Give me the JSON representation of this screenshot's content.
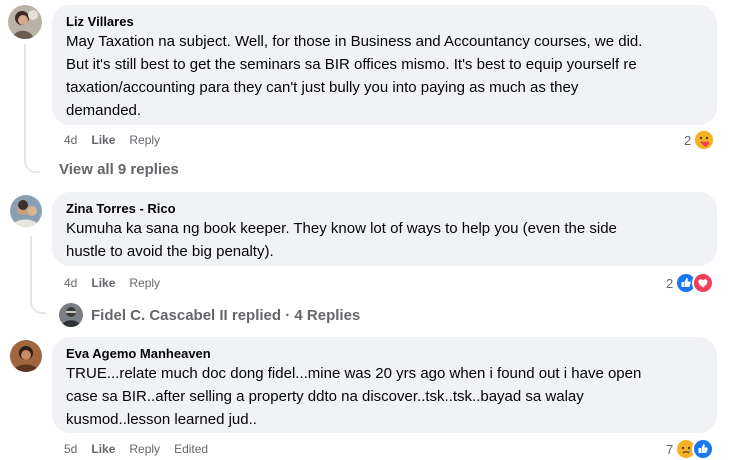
{
  "comments": [
    {
      "author": "Liz Villares",
      "lines": [
        "May Taxation na subject. Well, for those in Business and Accountancy courses, we did.",
        "But it's still best to get the seminars sa BIR offices mismo. It's best to equip yourself re",
        "taxation/accounting para they can't just bully you into paying as much as they",
        "demanded."
      ],
      "time": "4d",
      "like": "Like",
      "reply": "Reply",
      "reaction_count": "2",
      "reactions": [
        "care-icon"
      ]
    },
    {
      "author": "Zina Torres - Rico",
      "lines": [
        "Kumuha ka sana ng book keeper. They know lot of ways to help you (even the side",
        "hustle to avoid the big penalty)."
      ],
      "time": "4d",
      "like": "Like",
      "reply": "Reply",
      "reaction_count": "2",
      "reactions": [
        "like-icon",
        "love-icon"
      ]
    },
    {
      "author": "Eva Agemo Manheaven",
      "lines": [
        "TRUE...relate much doc dong fidel...mine was 20 yrs ago when i found out i have open",
        "case sa BIR..after selling a property ddto na discover..tsk..tsk..bayad sa walay",
        "kusmod..lesson learned jud.."
      ],
      "time": "5d",
      "like": "Like",
      "reply": "Reply",
      "edited": "Edited",
      "reaction_count": "7",
      "reactions": [
        "sad-icon",
        "like-icon"
      ]
    }
  ],
  "view_replies": "View all 9 replies",
  "replied": "Fidel C. Cascabel II replied · 4 Replies",
  "colors": {
    "bubble": "#f0f2f5",
    "meta": "#65676b",
    "like_blue": "#1877f2",
    "love_red": "#f33e58",
    "emoji_yellow": "#f7b125"
  }
}
